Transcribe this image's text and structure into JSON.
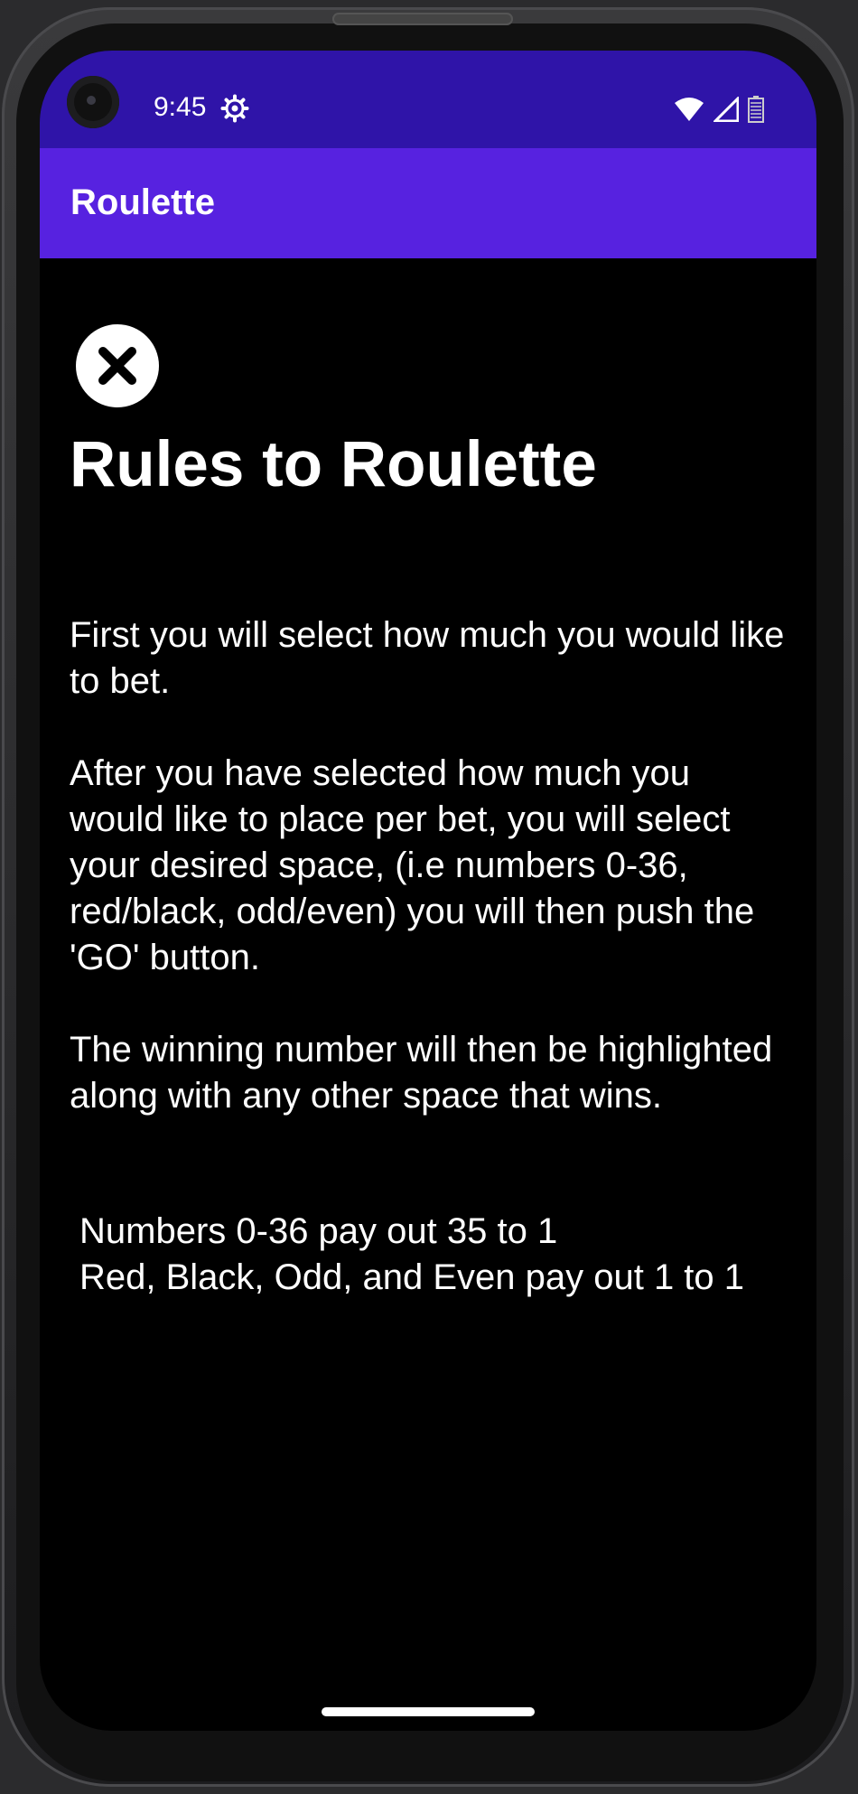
{
  "status_bar": {
    "time": "9:45",
    "icons": [
      "settings-gear-icon",
      "wifi-icon",
      "cellular-signal-icon",
      "battery-icon"
    ]
  },
  "app_bar": {
    "title": "Roulette"
  },
  "close_button": {
    "icon": "close-icon"
  },
  "rules": {
    "heading": "Rules to Roulette",
    "paragraphs": [
      "First you will select how much you would like to bet.",
      "After you have selected how much you would like to place per bet, you will select your desired space, (i.e numbers 0-36, red/black, odd/even) you will then push the 'GO' button.",
      "The winning number will then be highlighted along with any other space that wins."
    ],
    "payouts": [
      "Numbers 0-36 pay out 35 to 1",
      "Red, Black, Odd, and Even pay out 1 to 1"
    ]
  },
  "colors": {
    "status_bar": "#2f14a8",
    "app_bar": "#5722e0",
    "background": "#000000",
    "text": "#ffffff"
  }
}
